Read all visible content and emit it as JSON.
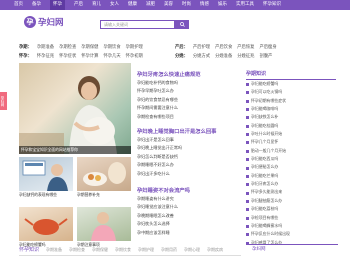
{
  "nav": {
    "items": [
      "首页",
      "备孕",
      "怀孕",
      "产后",
      "育儿",
      "女人",
      "健康",
      "减肥",
      "美容",
      "时尚",
      "情感",
      "娱乐",
      "实用工具",
      "怀孕知识"
    ],
    "current_index": 2
  },
  "logo": {
    "mark": "孕",
    "text": "孕妇网"
  },
  "search": {
    "placeholder": "请输入关键词"
  },
  "categories": {
    "row1": {
      "label": "孕期：",
      "links": [
        "孕期准备",
        "孕期检查",
        "孕期保健",
        "孕期饮食",
        "孕期护理",
        "孕期用药",
        "孕期心理",
        "孕期疾病"
      ]
    },
    "row2": {
      "label": "怀孕：",
      "links": [
        "怀孕征兆",
        "怀孕症状",
        "怀孕计算",
        "怀孕几天",
        "怀孕初期",
        "怀孕早期",
        "怀孕中期",
        "怀孕晚期"
      ]
    },
    "row1r": {
      "label": "产后：",
      "links": [
        "产后护理",
        "产后饮食",
        "产后恢复",
        "产后瘦身"
      ]
    },
    "row2r": {
      "label": "分娩：",
      "links": [
        "分娩方式",
        "分娩准备",
        "分娩征兆",
        "剖腹产"
      ]
    },
    "row3r": {
      "label": "育儿：",
      "links": [
        "新生儿",
        "婴儿",
        "幼儿",
        "学龄前"
      ]
    }
  },
  "sidetab": "孕妇网",
  "main_image": {
    "caption": "怀孕和宝宝知识全面的网站推荐你"
  },
  "small_images": [
    {
      "caption": "孕妇缺钙的表现有哪些"
    },
    {
      "caption": "孕期营养补充"
    },
    {
      "caption": "孕妇能吃螃蟹吗"
    },
    {
      "caption": "孕期注意事项"
    }
  ],
  "sections": [
    {
      "title": "孕妇牙疼怎么快速止痛规范",
      "items": [
        "孕妇能吃补钙的食物吗",
        "怀孕早期孕吐怎么办",
        "孕妇的饮食禁忌有哪些",
        "怀孕期间需要注意什么",
        "孕期检查有哪些项目"
      ]
    },
    {
      "title": "孕妇晚上睡觉胸口出汗是怎么回事",
      "items": [
        "孕妇出汗是怎么回事",
        "孕妇晚上睡觉出汗正常吗",
        "孕妇怎么判断是否缺钙",
        "孕期睡眠不好怎么办",
        "孕妇出汗多吃什么"
      ]
    },
    {
      "title": "孕妇睡姿不对会流产吗",
      "items": [
        "孕期睡姿有什么讲究",
        "孕妇睡觉应该注意什么",
        "孕晚期睡眠怎么改善",
        "孕妇枕头怎么选择",
        "孕中期应该怎样睡"
      ]
    }
  ],
  "right_column": {
    "title": "孕期知识",
    "items": [
      "孕妇能吃螃蟹吗",
      "孕妇可以吃火锅吗",
      "怀孕初期有哪些症状",
      "孕妇能喝咖啡吗",
      "孕妇缺铁怎么补",
      "孕妇能吃桂圆吗",
      "孕吐什么时候开始",
      "怀孕几个月显怀",
      "胎动一般几个月开始",
      "孕妇能吃西瓜吗",
      "孕妇便秘怎么办",
      "孕妇能吃芒果吗",
      "孕妇牙疼怎么办",
      "怀孕多久能测出来",
      "孕妇腿抽筋怎么办",
      "孕妇能吃荔枝吗",
      "孕检项目有哪些",
      "孕妇能喝蜂蜜水吗",
      "怀孕反应什么时候出现",
      "孕妇感冒了怎么办"
    ]
  },
  "bottom": {
    "title": "怀孕知识",
    "tabs": [
      "孕期准备",
      "孕期检查",
      "孕期保健",
      "孕期饮食",
      "孕期护理",
      "孕期用药",
      "孕期心理",
      "孕期疾病"
    ],
    "right_title": "孕妇网"
  },
  "colors": {
    "brand": "#7b54bd",
    "side_tab": "#f06a7e"
  }
}
